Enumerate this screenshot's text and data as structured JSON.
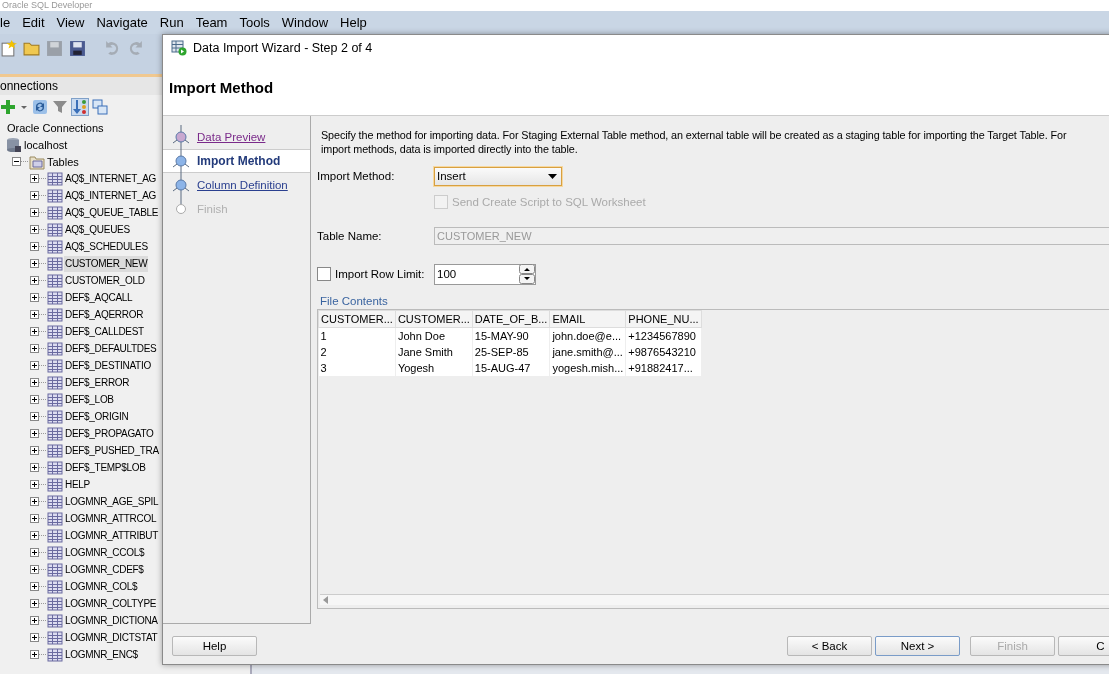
{
  "app": {
    "title": "Oracle SQL Developer",
    "menu": [
      "le",
      "Edit",
      "View",
      "Navigate",
      "Run",
      "Team",
      "Tools",
      "Window",
      "Help"
    ]
  },
  "connections": {
    "title": "onnections",
    "tree": [
      {
        "label": "Oracle Connections",
        "kind": "root",
        "children": [
          {
            "label": "localhost",
            "kind": "connection",
            "children": [
              {
                "label": "Tables",
                "kind": "folder",
                "expanded": true,
                "children": [
                  {
                    "label": "AQ$_INTERNET_AG",
                    "kind": "table",
                    "expanded": false,
                    "selected": false
                  },
                  {
                    "label": "AQ$_INTERNET_AG",
                    "kind": "table",
                    "expanded": false,
                    "selected": false
                  },
                  {
                    "label": "AQ$_QUEUE_TABLE",
                    "kind": "table",
                    "expanded": false,
                    "selected": false
                  },
                  {
                    "label": "AQ$_QUEUES",
                    "kind": "table",
                    "expanded": false,
                    "selected": false
                  },
                  {
                    "label": "AQ$_SCHEDULES",
                    "kind": "table",
                    "expanded": false,
                    "selected": false
                  },
                  {
                    "label": "CUSTOMER_NEW",
                    "kind": "table",
                    "expanded": false,
                    "selected": true
                  },
                  {
                    "label": "CUSTOMER_OLD",
                    "kind": "table",
                    "expanded": false,
                    "selected": false
                  },
                  {
                    "label": "DEF$_AQCALL",
                    "kind": "table",
                    "expanded": false,
                    "selected": false
                  },
                  {
                    "label": "DEF$_AQERROR",
                    "kind": "table",
                    "expanded": false,
                    "selected": false
                  },
                  {
                    "label": "DEF$_CALLDEST",
                    "kind": "table",
                    "expanded": false,
                    "selected": false
                  },
                  {
                    "label": "DEF$_DEFAULTDES",
                    "kind": "table",
                    "expanded": false,
                    "selected": false
                  },
                  {
                    "label": "DEF$_DESTINATIO",
                    "kind": "table",
                    "expanded": false,
                    "selected": false
                  },
                  {
                    "label": "DEF$_ERROR",
                    "kind": "table",
                    "expanded": false,
                    "selected": false
                  },
                  {
                    "label": "DEF$_LOB",
                    "kind": "table",
                    "expanded": false,
                    "selected": false
                  },
                  {
                    "label": "DEF$_ORIGIN",
                    "kind": "table",
                    "expanded": false,
                    "selected": false
                  },
                  {
                    "label": "DEF$_PROPAGATO",
                    "kind": "table",
                    "expanded": false,
                    "selected": false
                  },
                  {
                    "label": "DEF$_PUSHED_TRA",
                    "kind": "table",
                    "expanded": false,
                    "selected": false
                  },
                  {
                    "label": "DEF$_TEMP$LOB",
                    "kind": "table",
                    "expanded": false,
                    "selected": false
                  },
                  {
                    "label": "HELP",
                    "kind": "table",
                    "expanded": false,
                    "selected": false
                  },
                  {
                    "label": "LOGMNR_AGE_SPIL",
                    "kind": "table",
                    "expanded": false,
                    "selected": false
                  },
                  {
                    "label": "LOGMNR_ATTRCOL",
                    "kind": "table",
                    "expanded": false,
                    "selected": false
                  },
                  {
                    "label": "LOGMNR_ATTRIBUT",
                    "kind": "table",
                    "expanded": false,
                    "selected": false
                  },
                  {
                    "label": "LOGMNR_CCOL$",
                    "kind": "table",
                    "expanded": false,
                    "selected": false
                  },
                  {
                    "label": "LOGMNR_CDEF$",
                    "kind": "table",
                    "expanded": false,
                    "selected": false
                  },
                  {
                    "label": "LOGMNR_COL$",
                    "kind": "table",
                    "expanded": false,
                    "selected": false
                  },
                  {
                    "label": "LOGMNR_COLTYPE",
                    "kind": "table",
                    "expanded": false,
                    "selected": false
                  },
                  {
                    "label": "LOGMNR_DICTIONA",
                    "kind": "table",
                    "expanded": false,
                    "selected": false
                  },
                  {
                    "label": "LOGMNR_DICTSTAT",
                    "kind": "table",
                    "expanded": false,
                    "selected": false
                  },
                  {
                    "label": "LOGMNR_ENC$",
                    "kind": "table",
                    "expanded": false,
                    "selected": false
                  }
                ]
              }
            ]
          }
        ]
      }
    ]
  },
  "dialog": {
    "title": "Data Import Wizard - Step 2 of 4",
    "heading": "Import Method",
    "steps": [
      {
        "label": "Data Preview",
        "selected": false,
        "visited": true,
        "disabled": false
      },
      {
        "label": "Import Method",
        "selected": true,
        "visited": false,
        "disabled": false
      },
      {
        "label": "Column Definition",
        "selected": false,
        "visited": false,
        "disabled": false
      },
      {
        "label": "Finish",
        "selected": false,
        "visited": false,
        "disabled": true
      }
    ],
    "description": "Specify the method for importing data.  For Staging External Table method, an external table will be created as a staging table for importing the Target Table.  For\nimport methods, data is imported directly into the table.",
    "import_method": {
      "label": "Import Method:",
      "value": "Insert"
    },
    "send_script": {
      "label": "Send Create Script to SQL Worksheet",
      "checked": false,
      "disabled": true
    },
    "table_name": {
      "label": "Table Name:",
      "value": "CUSTOMER_NEW",
      "disabled": true
    },
    "row_limit": {
      "label": "Import Row Limit:",
      "checked": false,
      "value": "100"
    },
    "file_contents": {
      "title": "File Contents",
      "columns": [
        "CUSTOMER...",
        "CUSTOMER...",
        "DATE_OF_B...",
        "EMAIL",
        "PHONE_NU..."
      ],
      "rows": [
        [
          "1",
          "John Doe",
          "15-MAY-90",
          "john.doe@e...",
          "+1234567890"
        ],
        [
          "2",
          "Jane Smith",
          "25-SEP-85",
          "jane.smith@...",
          "+9876543210"
        ],
        [
          "3",
          "Yogesh",
          "15-AUG-47",
          "yogesh.mish...",
          "+91882417..."
        ]
      ]
    },
    "help_button": {
      "label": "Help"
    },
    "buttons": [
      {
        "label": "< Back",
        "disabled": false,
        "default": false
      },
      {
        "label": "Next >",
        "disabled": false,
        "default": true
      },
      {
        "label": "Finish",
        "disabled": true,
        "default": false
      },
      {
        "label": "C",
        "disabled": false,
        "default": false
      }
    ]
  }
}
